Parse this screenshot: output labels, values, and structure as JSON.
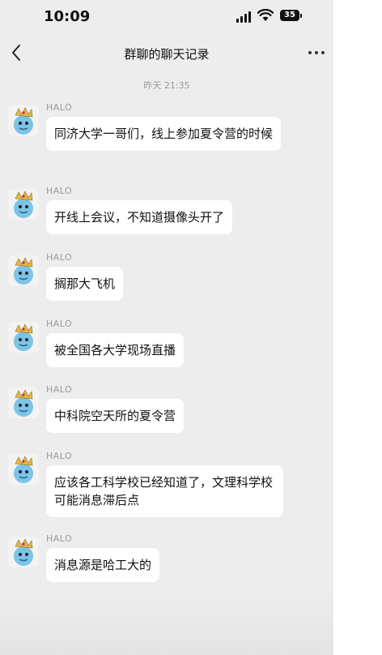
{
  "status_bar": {
    "time": "10:09",
    "battery": "35"
  },
  "nav": {
    "title": "群聊的聊天记录"
  },
  "timestamp": "昨天 21:35",
  "messages": [
    {
      "sender": "HALO",
      "text": "同济大学一哥们，线上参加夏令营的时候"
    },
    {
      "sender": "HALO",
      "text": "开线上会议，不知道摄像头开了"
    },
    {
      "sender": "HALO",
      "text": "搁那大飞机"
    },
    {
      "sender": "HALO",
      "text": "被全国各大学现场直播"
    },
    {
      "sender": "HALO",
      "text": "中科院空天所的夏令营"
    },
    {
      "sender": "HALO",
      "text": "应该各工科学校已经知道了，文理科学校可能消息滞后点"
    },
    {
      "sender": "HALO",
      "text": "消息源是哈工大的"
    }
  ],
  "icons": {
    "back": "chevron-left-icon",
    "more": "more-dots-icon",
    "avatar": "cartoon-avatar"
  }
}
